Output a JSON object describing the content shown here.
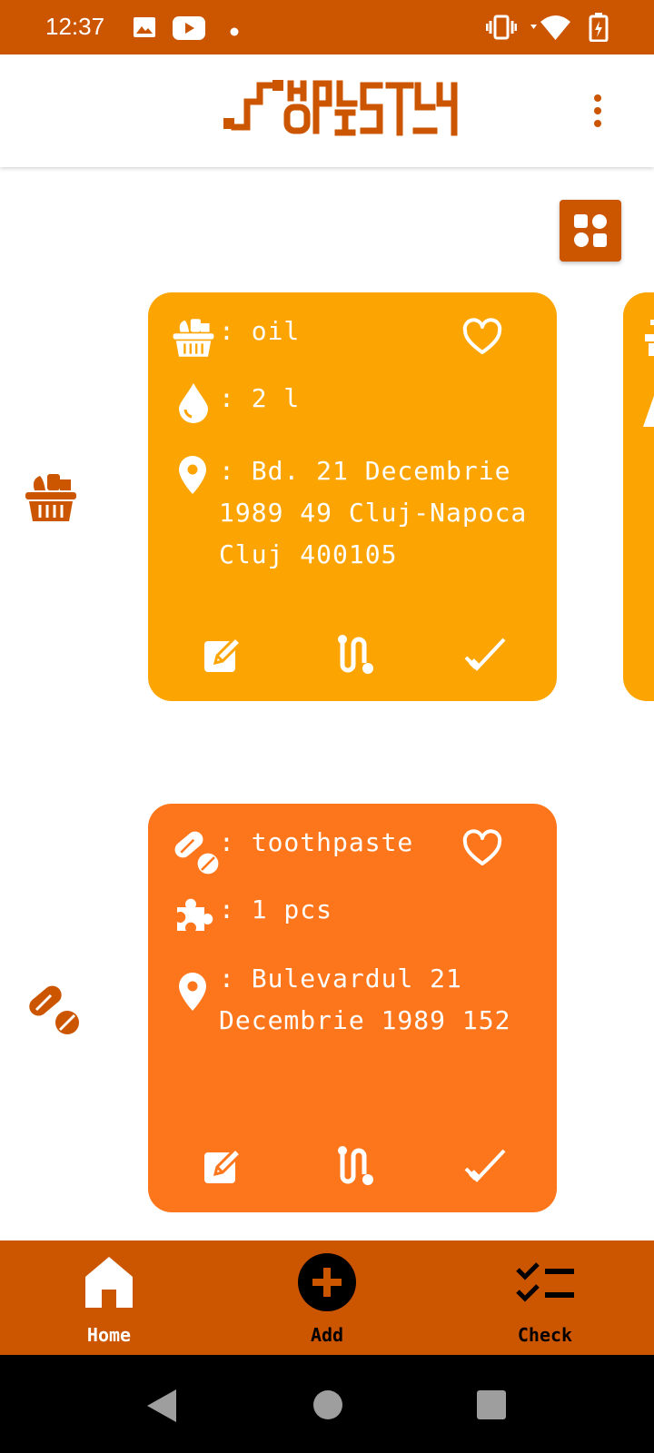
{
  "status_bar": {
    "time": "12:37",
    "icons": [
      "image-icon",
      "youtube-icon",
      "dot-icon",
      "vibrate-icon",
      "wifi-icon",
      "battery-charging-icon"
    ]
  },
  "app_bar": {
    "logo_text": "SHOPLISTLY",
    "menu_icon": "more-vert-icon"
  },
  "view_toggle": {
    "icon": "dashboard-icon"
  },
  "items": [
    {
      "category_icon": "grocery-basket-icon",
      "name": ": oil",
      "quantity_icon": "drop-icon",
      "quantity": ": 2 l",
      "location": ": Bd. 21 Decembrie\n1989 49 Cluj-Napoca\nCluj 400105",
      "color": "#fca502"
    },
    {
      "category_icon": "pills-icon",
      "name": ": toothpaste",
      "quantity_icon": "puzzle-icon",
      "quantity": ": 1 pcs",
      "location": ": Bulevardul 21\nDecembrie 1989 152",
      "color": "#fe761c"
    }
  ],
  "bottom_nav": {
    "home": "Home",
    "add": "Add",
    "check": "Check"
  },
  "colors": {
    "primary": "#cc5500",
    "card_grocery": "#fca502",
    "card_pharmacy": "#fe761c"
  }
}
